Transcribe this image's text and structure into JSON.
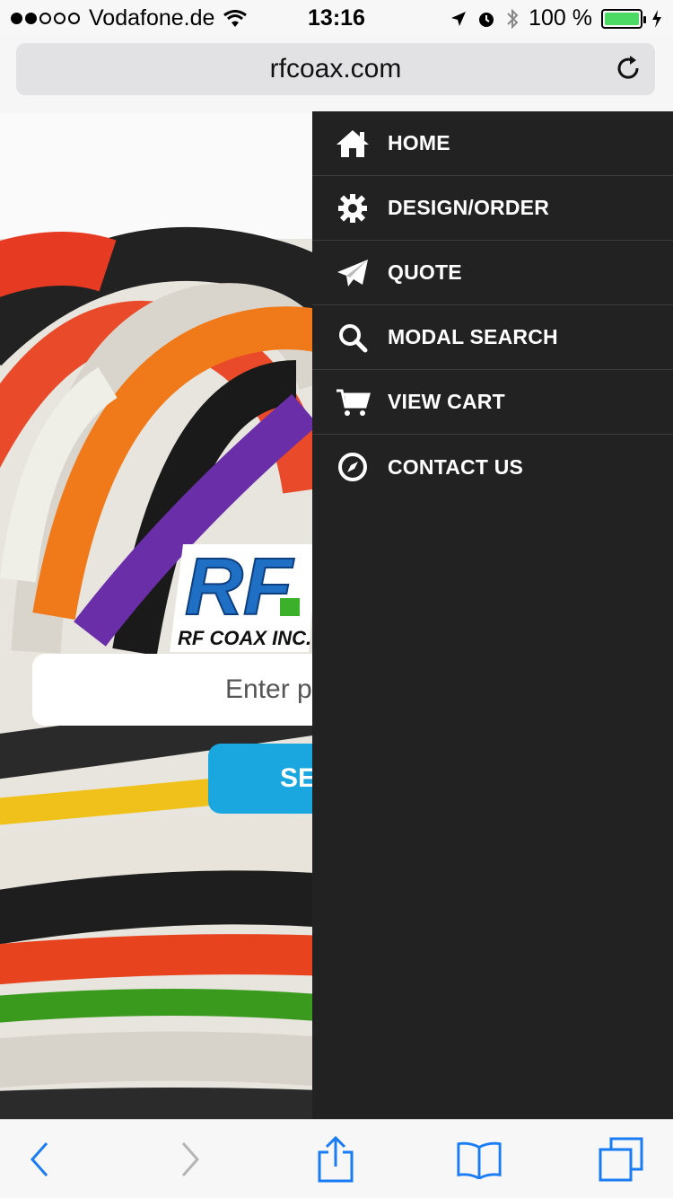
{
  "status_bar": {
    "carrier": "Vodafone.de",
    "time": "13:16",
    "battery": "100 %"
  },
  "browser": {
    "url": "rfcoax.com"
  },
  "page": {
    "logo_main": "RF",
    "logo_sub": "RF COAX INC.",
    "search_placeholder": "Enter p",
    "search_button": "SE"
  },
  "drawer": {
    "items": [
      {
        "label": "HOME",
        "icon": "home-icon"
      },
      {
        "label": "DESIGN/ORDER",
        "icon": "gear-icon"
      },
      {
        "label": "QUOTE",
        "icon": "paper-plane-icon"
      },
      {
        "label": "MODAL SEARCH",
        "icon": "search-icon"
      },
      {
        "label": "VIEW CART",
        "icon": "cart-icon"
      },
      {
        "label": "CONTACT US",
        "icon": "compass-icon"
      }
    ]
  },
  "colors": {
    "drawer_bg": "#222222",
    "accent_blue": "#1aa7e0",
    "battery_green": "#4cd964"
  }
}
